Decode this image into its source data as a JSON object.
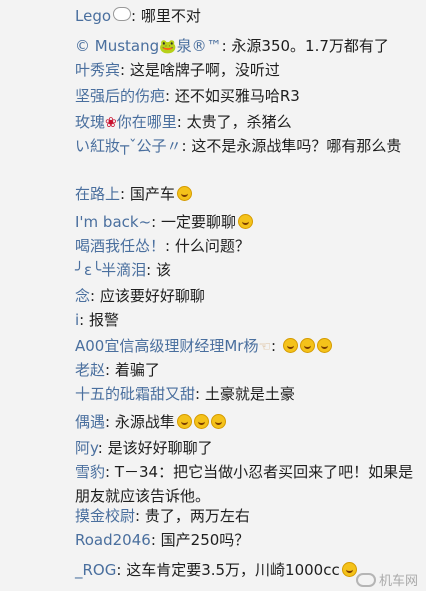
{
  "comments": [
    {
      "name": "Lego",
      "text": "哪里不对"
    },
    {
      "name": "© Mustang",
      "name2": "泉®™",
      "text": "永源350。1.7万都有了"
    },
    {
      "name": "叶秀宾",
      "text": "这是啥牌子啊，没听过"
    },
    {
      "name": "坚强后的伤疤",
      "text": "还不如买雅马哈R3"
    },
    {
      "name": "玫瑰",
      "name2": "你在哪里",
      "text": "太贵了，杀猪么"
    },
    {
      "name": "い紅妝┬ˇ公子〃",
      "text": "这不是永源战隼吗？哪有那么贵"
    },
    {
      "name": "在路上",
      "text": "国产车"
    },
    {
      "name": "I'm back~",
      "text": "一定要聊聊"
    },
    {
      "name": "喝酒我任怂！",
      "text": "什么问题？"
    },
    {
      "name": "╯ε╰半滴泪",
      "text": "该"
    },
    {
      "name": "念",
      "text": "应该要好好聊聊"
    },
    {
      "name": "i",
      "text": "报警"
    },
    {
      "name": "A00宜信高级理财经理Mr杨",
      "text": ""
    },
    {
      "name": "老赵",
      "text": "着骗了"
    },
    {
      "name": "十五的砒霜甜又甜",
      "text": "土豪就是土豪"
    },
    {
      "name": "偶遇",
      "text": "永源战隼"
    },
    {
      "name": "阿y",
      "text": "是该好好聊聊了"
    },
    {
      "name": "雪豹",
      "text": "T－34：把它当做小忍者买回来了吧！如果是朋友就应该告诉他。"
    },
    {
      "name": "摸金校尉",
      "text": "贵了，两万左右"
    },
    {
      "name": "Road2046",
      "text": "国产250吗？"
    },
    {
      "name": "_ROG",
      "text": "这车肯定要3.5万，川崎1000cc"
    }
  ],
  "separator": ": ",
  "watermark": "机车网",
  "colors": {
    "name": "#4a6f9e",
    "text": "#1e1e1e",
    "background": "#f3f3f3"
  }
}
